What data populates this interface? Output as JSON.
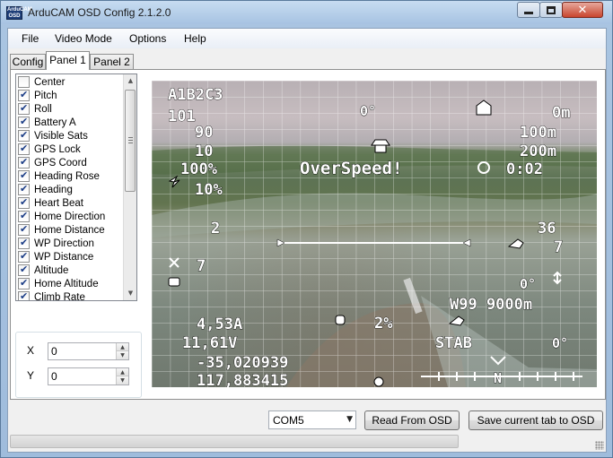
{
  "window": {
    "title": "ArduCAM OSD Config 2.1.2.0",
    "icon_text": "ArduCAM OSD"
  },
  "menu": [
    "File",
    "Video Mode",
    "Options",
    "Help"
  ],
  "tabs": [
    {
      "label": "Config",
      "active": false
    },
    {
      "label": "Panel 1",
      "active": true
    },
    {
      "label": "Panel 2",
      "active": false
    }
  ],
  "panel_items": [
    {
      "label": "Center",
      "checked": false
    },
    {
      "label": "Pitch",
      "checked": true
    },
    {
      "label": "Roll",
      "checked": true
    },
    {
      "label": "Battery A",
      "checked": true
    },
    {
      "label": "Visible Sats",
      "checked": true
    },
    {
      "label": "GPS Lock",
      "checked": true
    },
    {
      "label": "GPS Coord",
      "checked": true
    },
    {
      "label": "Heading Rose",
      "checked": true
    },
    {
      "label": "Heading",
      "checked": true
    },
    {
      "label": "Heart Beat",
      "checked": true
    },
    {
      "label": "Home Direction",
      "checked": true
    },
    {
      "label": "Home Distance",
      "checked": true
    },
    {
      "label": "WP Direction",
      "checked": true
    },
    {
      "label": "WP Distance",
      "checked": true
    },
    {
      "label": "Altitude",
      "checked": true
    },
    {
      "label": "Home Altitude",
      "checked": true
    },
    {
      "label": "Climb Rate",
      "checked": true
    }
  ],
  "position": {
    "x_label": "X",
    "x_value": "0",
    "y_label": "Y",
    "y_value": "0"
  },
  "osd": {
    "panel_a": "A1B2C3",
    "airspeed": "101",
    "groundspeed": "90",
    "throttle1": "10",
    "throttle2": "100%",
    "battery_pct": "10%",
    "climb": "2",
    "sats": "7",
    "current": "4,53A",
    "voltage": "11,61V",
    "latitude": "-35,020939",
    "longitude": "117,883415",
    "roll": "0°",
    "warning": "OverSpeed!",
    "home_dist": "0m",
    "alt1": "100m",
    "alt2": "200m",
    "timer": "0:02",
    "wind": "36",
    "wind2": "7",
    "pitch": "0°",
    "waypoint": "W99 9000m",
    "rssi": "2%",
    "mode": "STAB",
    "heading": "0°",
    "compass_n": "N"
  },
  "bottom": {
    "port": "COM5",
    "read_button": "Read From OSD",
    "save_button": "Save current tab to OSD",
    "progress_fraction": 0.0
  }
}
